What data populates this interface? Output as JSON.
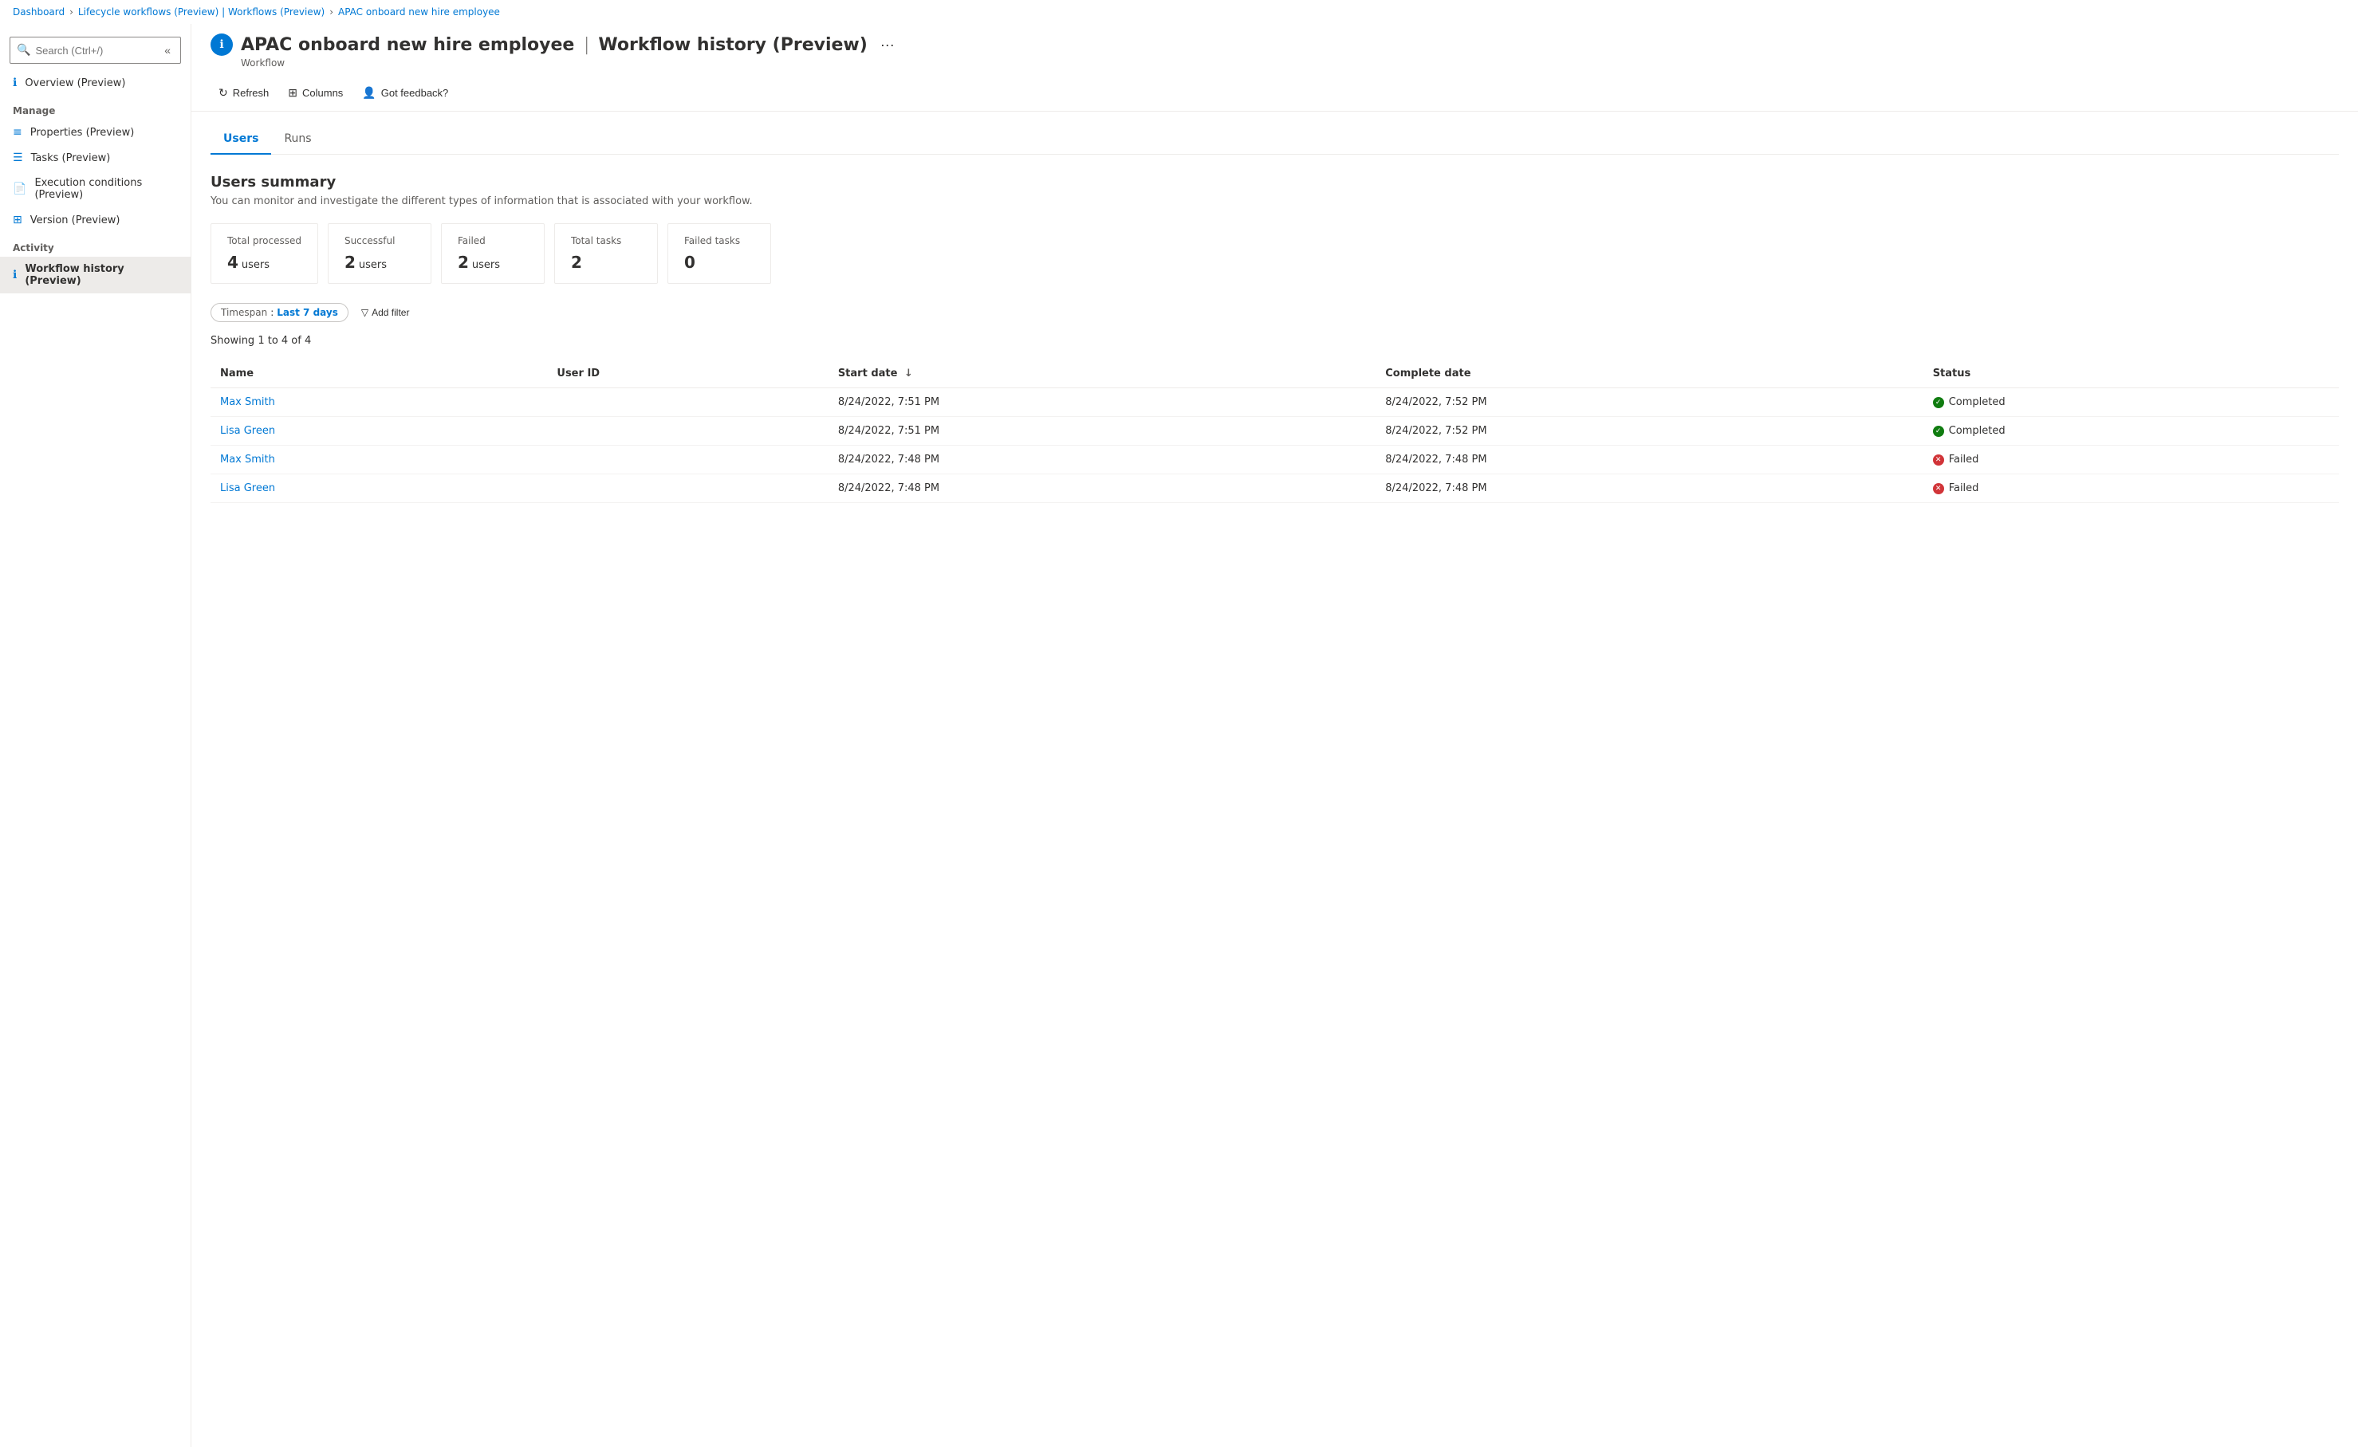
{
  "breadcrumb": {
    "items": [
      {
        "label": "Dashboard",
        "href": "#"
      },
      {
        "label": "Lifecycle workflows (Preview) | Workflows (Preview)",
        "href": "#"
      },
      {
        "label": "APAC onboard new hire employee",
        "href": "#"
      }
    ]
  },
  "page": {
    "title": "APAC onboard new hire employee",
    "title_separator": "|",
    "subtitle_part": "Workflow history (Preview)",
    "type_label": "Workflow",
    "more_icon": "···"
  },
  "toolbar": {
    "refresh_label": "Refresh",
    "columns_label": "Columns",
    "feedback_label": "Got feedback?"
  },
  "sidebar": {
    "search_placeholder": "Search (Ctrl+/)",
    "collapse_icon": "«",
    "overview_label": "Overview (Preview)",
    "manage_section": "Manage",
    "manage_items": [
      {
        "label": "Properties (Preview)",
        "icon": "bars"
      },
      {
        "label": "Tasks (Preview)",
        "icon": "list"
      },
      {
        "label": "Execution conditions (Preview)",
        "icon": "doc"
      },
      {
        "label": "Version (Preview)",
        "icon": "layers"
      }
    ],
    "activity_section": "Activity",
    "activity_items": [
      {
        "label": "Workflow history (Preview)",
        "icon": "info",
        "active": true
      }
    ]
  },
  "tabs": [
    {
      "label": "Users",
      "active": true
    },
    {
      "label": "Runs",
      "active": false
    }
  ],
  "summary": {
    "title": "Users summary",
    "description": "You can monitor and investigate the different types of information that is associated with your workflow.",
    "stats": [
      {
        "label": "Total processed",
        "value": "4",
        "unit": "users"
      },
      {
        "label": "Successful",
        "value": "2",
        "unit": "users"
      },
      {
        "label": "Failed",
        "value": "2",
        "unit": "users"
      },
      {
        "label": "Total tasks",
        "value": "2",
        "unit": ""
      },
      {
        "label": "Failed tasks",
        "value": "0",
        "unit": ""
      }
    ]
  },
  "filters": {
    "timespan_label": "Timespan",
    "timespan_value": "Last 7 days",
    "add_filter_label": "Add filter"
  },
  "table": {
    "showing_text": "Showing 1 to 4 of 4",
    "columns": [
      {
        "label": "Name",
        "sortable": false
      },
      {
        "label": "User ID",
        "sortable": false
      },
      {
        "label": "Start date",
        "sortable": true,
        "sort_dir": "↓"
      },
      {
        "label": "Complete date",
        "sortable": false
      },
      {
        "label": "Status",
        "sortable": false
      }
    ],
    "rows": [
      {
        "name": "Max Smith",
        "user_id": "",
        "start_date": "8/24/2022, 7:51 PM",
        "complete_date": "8/24/2022, 7:52 PM",
        "status": "Completed",
        "status_type": "completed"
      },
      {
        "name": "Lisa Green",
        "user_id": "",
        "start_date": "8/24/2022, 7:51 PM",
        "complete_date": "8/24/2022, 7:52 PM",
        "status": "Completed",
        "status_type": "completed"
      },
      {
        "name": "Max Smith",
        "user_id": "",
        "start_date": "8/24/2022, 7:48 PM",
        "complete_date": "8/24/2022, 7:48 PM",
        "status": "Failed",
        "status_type": "failed"
      },
      {
        "name": "Lisa Green",
        "user_id": "",
        "start_date": "8/24/2022, 7:48 PM",
        "complete_date": "8/24/2022, 7:48 PM",
        "status": "Failed",
        "status_type": "failed"
      }
    ]
  }
}
